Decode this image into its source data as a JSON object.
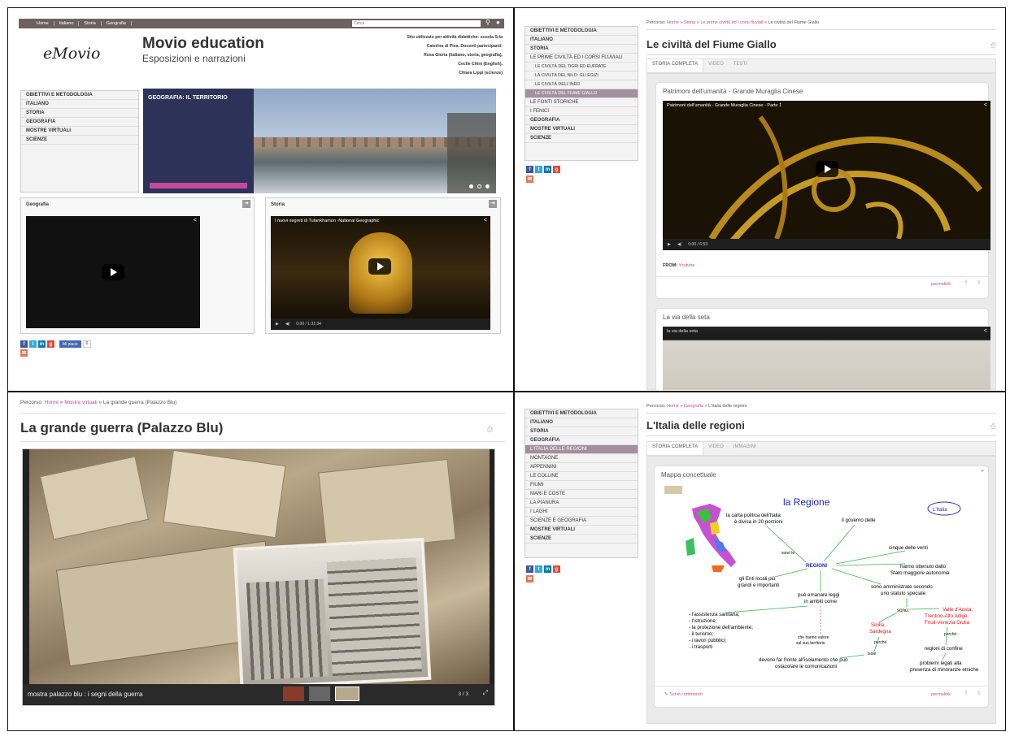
{
  "q1": {
    "nav": [
      "Home",
      "Italiano",
      "Storia",
      "Geografia"
    ],
    "search_placeholder": "Cerca",
    "logo": "eMovio",
    "site_title": "Movio education",
    "site_subtitle": "Esposizioni e narrazioni",
    "info": [
      "Sito utilizzato per attività didattiche: scuola S.ta",
      "Caterina di Pisa. Docenti partecipanti:",
      "Rosa Gioria (italiano, storia, geografia),",
      "Cecile Chini (English),",
      "Chiara Lippi (scienze)"
    ],
    "menu": [
      "OBIETTIVI E METODOLOGIA",
      "ITALIANO",
      "STORIA",
      "GEOGRAFIA",
      "MOSTRE VIRTUALI",
      "SCIENZE"
    ],
    "slide_title": "GEOGRAFIA: IL TERRITORIO",
    "box1_title": "Geografia",
    "box2_title": "Storia",
    "video2_title": "I nuovi segreti di Tutankhamon -National Geographic",
    "video2_time": "0:00 / 1:31:34",
    "like_label": "Mi piace",
    "like_count": "0"
  },
  "q2": {
    "menu": [
      {
        "t": "OBIETTIVI E METODOLOGIA",
        "c": "it"
      },
      {
        "t": "ITALIANO",
        "c": "it"
      },
      {
        "t": "STORIA",
        "c": "it"
      },
      {
        "t": "LE PRIME CIVILTÀ ED I CORSI FLUVIALI",
        "c": "it sub"
      },
      {
        "t": "LE CIVILTÀ DEL TIGRI ED EUFRATE",
        "c": "it subsub"
      },
      {
        "t": "LA CIVILTÀ DEL NILO: GLI EGIZI",
        "c": "it subsub"
      },
      {
        "t": "LE CIVILTÀ DELL'INDO",
        "c": "it subsub"
      },
      {
        "t": "LE CIVILTÀ DEL FIUME GIALLO",
        "c": "it subsub sel"
      },
      {
        "t": "LE FONTI STORICHE",
        "c": "it sub"
      },
      {
        "t": "I FENICI",
        "c": "it sub"
      },
      {
        "t": "GEOGRAFIA",
        "c": "it"
      },
      {
        "t": "MOSTRE VIRTUALI",
        "c": "it"
      },
      {
        "t": "SCIENZE",
        "c": "it"
      }
    ],
    "bc_label": "Percorso:",
    "bc": [
      "Home",
      "Storia",
      "Le prime civiltà ed i corsi fluviali"
    ],
    "bc_current": "Le civiltà del Fiume Giallo",
    "title": "Le civiltà del Fiume Giallo",
    "tabs": [
      "STORIA COMPLETA",
      "VIDEO",
      "TESTI"
    ],
    "card1_title": "Patrimoni dell'umanità - Grande Muraglia Cinese",
    "video1_title": "Patrimoni dell'umanità - Grande Muraglia Cinese - Parte 1",
    "video1_time": "0:00 / 6:53",
    "from_label": "FROM:",
    "from_value": "Youtube",
    "permalink": "permalink",
    "card2_title": "La via della seta",
    "video2_title": "la via della seta"
  },
  "q3": {
    "bc_label": "Percorso:",
    "bc": [
      "Home",
      "Mostre virtuali"
    ],
    "bc_current": "La grande guerra (Palazzo Blu)",
    "title": "La grande guerra (Palazzo Blu)",
    "caption": "mostra palazzo blu : i segni della guerra",
    "counter": "3 / 3"
  },
  "q4": {
    "menu": [
      {
        "t": "OBIETTIVI E METODOLOGIA",
        "c": "it"
      },
      {
        "t": "ITALIANO",
        "c": "it"
      },
      {
        "t": "STORIA",
        "c": "it"
      },
      {
        "t": "GEOGRAFIA",
        "c": "it"
      },
      {
        "t": "L'ITALIA DELLE REGIONI",
        "c": "it sub sel"
      },
      {
        "t": "MONTAGNE",
        "c": "it sub"
      },
      {
        "t": "APPENNINI",
        "c": "it sub"
      },
      {
        "t": "LE COLLINE",
        "c": "it sub"
      },
      {
        "t": "FIUMI",
        "c": "it sub"
      },
      {
        "t": "MARI E COSTE",
        "c": "it sub"
      },
      {
        "t": "LA PIANURA",
        "c": "it sub"
      },
      {
        "t": "I LAGHI",
        "c": "it sub"
      },
      {
        "t": "SCIENZE E GEOGRAFIA",
        "c": "it sub"
      },
      {
        "t": "MOSTRE VIRTUALI",
        "c": "it"
      },
      {
        "t": "SCIENZE",
        "c": "it"
      }
    ],
    "bc_label": "Percorso:",
    "bc": [
      "Home",
      "Geografia"
    ],
    "bc_current": "L'Italia delle regioni",
    "title": "L'Italia delle regioni",
    "tabs": [
      "STORIA COMPLETA",
      "VIDEO",
      "IMMAGINI"
    ],
    "card_title": "Mappa concettuale",
    "map": {
      "title": "la  Regione",
      "italia": "L'Italia",
      "center": "REGIONI",
      "n1": [
        "la carta politica  dell'Italia",
        "è divisa in 20 porzioni"
      ],
      "n2": "il governo delle",
      "n3": "cinque  delle  venti",
      "n4": [
        "hanno  ottenuto dallo",
        "Stato  maggiore  autonomia"
      ],
      "n5": [
        "sono  amministrate  secondo",
        "uno statuto  speciale"
      ],
      "n6": [
        "gli  Enti  locali  più",
        "grandi  e  importanti"
      ],
      "n7": [
        "può  emanare leggi",
        "in  ambiti  come"
      ],
      "sono_le": "sono le",
      "sono": "sono:",
      "list": [
        "- l'assistenza  sanitaria;",
        "- l'istruzione;",
        "- la  protezione  dell'ambiente;",
        "- il  turismo;",
        "- i  lavori  pubblici;",
        "- i  trasporti"
      ],
      "chv": [
        "che hanno valore",
        "sul suo territorio"
      ],
      "isole": [
        "Sicilia,",
        "Sardegna"
      ],
      "regs": [
        "Valle  d'Aosta,",
        "Trentino-Alto  Adige,",
        "Friuli-Venezia  Giulia"
      ],
      "perche": "perchè",
      "isole_label": "isole",
      "devono": [
        "devono  far  fronte  all'isolamento  che  può",
        "ostacolare  le  comunicazioni"
      ],
      "confine": "regioni  di  confine",
      "problemi": [
        "problemi  legati  alla",
        "presenza  di  minoranze  etniche"
      ]
    },
    "comment": "Scrivi commento",
    "permalink": "permalink"
  },
  "colors": {
    "accent": "#c34a9a",
    "topbar": "#6b6163",
    "slide_panel": "#2d3358",
    "video_bg": "#111111"
  }
}
